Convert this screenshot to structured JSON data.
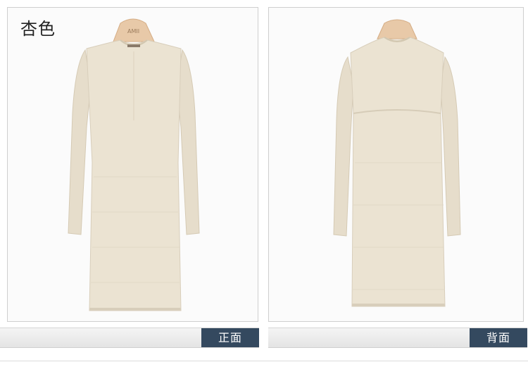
{
  "color_label": "杏色",
  "views": [
    {
      "label": "正面"
    },
    {
      "label": "背面"
    }
  ],
  "hanger_brand": "AMII",
  "colors": {
    "garment": "#e9e1d0",
    "garment_shadow": "#d8cebb",
    "label_bg": "#34495f",
    "label_text": "#ffffff"
  }
}
